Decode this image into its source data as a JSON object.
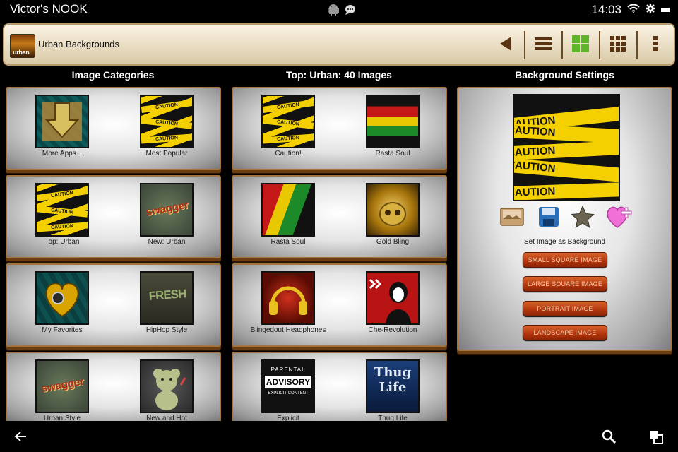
{
  "status_bar": {
    "device_name": "Victor's NOOK",
    "time": "14:03",
    "icons": [
      "android-icon",
      "chat-icon",
      "wifi-icon",
      "gear-icon",
      "battery-icon"
    ]
  },
  "action_bar": {
    "app_title": "Urban Backgrounds",
    "app_icon_text": "urban",
    "buttons": [
      "back-arrow-icon",
      "list-view-icon",
      "grid-view-icon",
      "small-grid-icon",
      "overflow-menu-icon"
    ]
  },
  "columns": {
    "categories_title": "Image Categories",
    "images_title": "Top: Urban: 40 Images",
    "settings_title": "Background Settings"
  },
  "categories": [
    {
      "label": "More Apps..."
    },
    {
      "label": "Most Popular"
    },
    {
      "label": "Top: Urban"
    },
    {
      "label": "New: Urban"
    },
    {
      "label": "My Favorites"
    },
    {
      "label": "HipHop Style"
    },
    {
      "label": "Urban Style"
    },
    {
      "label": "New and Hot"
    }
  ],
  "images": [
    {
      "label": "Caution!"
    },
    {
      "label": "Rasta Soul"
    },
    {
      "label": "Rasta Soul"
    },
    {
      "label": "Gold Bling"
    },
    {
      "label": "Blingedout Headphones"
    },
    {
      "label": "Che-Revolution"
    },
    {
      "label": "Explicit"
    },
    {
      "label": "Thug Life"
    }
  ],
  "thumb_text": {
    "caution": "CAUTION",
    "swagger": "swagger",
    "fresh": "FRESH",
    "parental": "PARENTAL",
    "advisory": "ADVISORY",
    "explicit_content": "EXPLICIT CONTENT",
    "thug": "Thug",
    "life": "Life",
    "urban": "urban"
  },
  "settings": {
    "preview_text": "CAUTION",
    "icons": [
      "wallpaper-icon",
      "save-disk-icon",
      "star-icon",
      "heart-add-icon"
    ],
    "set_label": "Set Image as Background",
    "buttons": {
      "small_square": "SMALL SQUARE IMAGE",
      "large_square": "LARGE SQUARE IMAGE",
      "portrait": "PORTRAIT IMAGE",
      "landscape": "LANDSCAPE IMAGE"
    }
  },
  "bottom_bar": {
    "icons": [
      "back-icon",
      "search-icon",
      "recent-apps-icon"
    ]
  },
  "colors": {
    "accent_orange": "#b2350d",
    "shelf_wood": "#a27440",
    "caution_yellow": "#f4d000",
    "grid_active_green": "#5fb52a"
  }
}
